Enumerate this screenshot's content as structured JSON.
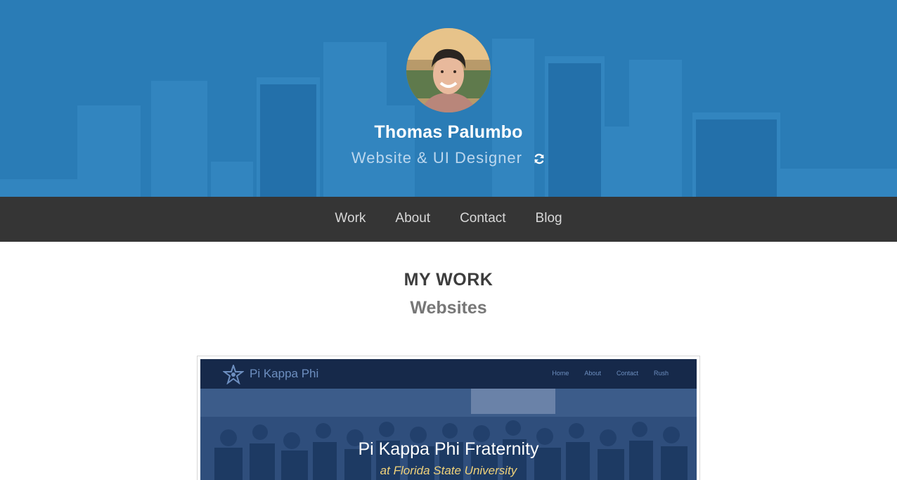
{
  "profile": {
    "name": "Thomas Palumbo",
    "role": "Website & UI Designer"
  },
  "nav": {
    "items": [
      "Work",
      "About",
      "Contact",
      "Blog"
    ]
  },
  "work": {
    "title": "MY WORK",
    "subtitle": "Websites"
  },
  "preview": {
    "brand": "Pi Kappa Phi",
    "nav": [
      "Home",
      "About",
      "Contact",
      "Rush"
    ],
    "title": "Pi Kappa Phi Fraternity",
    "subtitle": "at Florida State University"
  },
  "colors": {
    "hero_blue": "#2a7cb6",
    "nav_bg": "#353535",
    "preview_header": "#16294a"
  },
  "icons": {
    "refresh": "refresh-icon",
    "logo": "star-logo-icon"
  }
}
